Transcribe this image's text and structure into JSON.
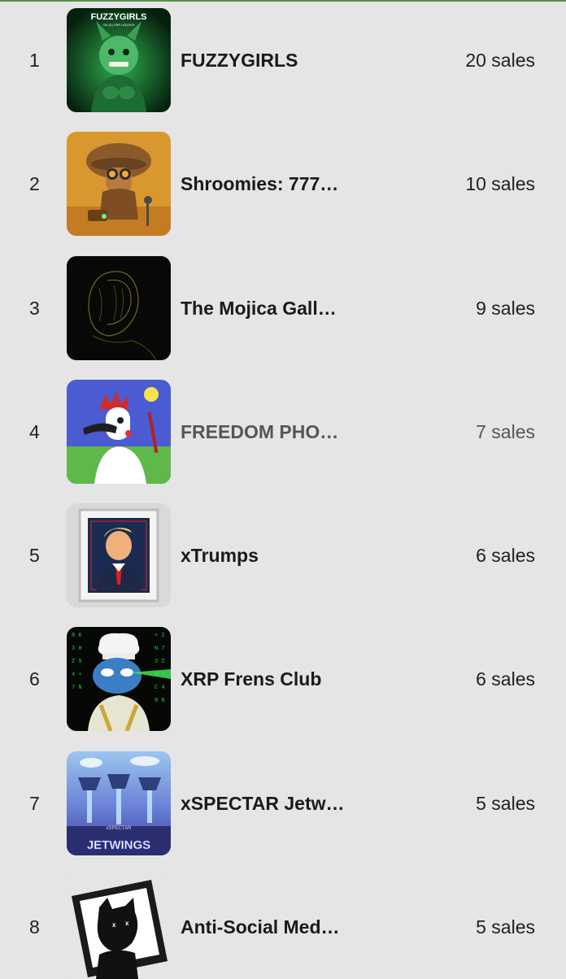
{
  "collections": [
    {
      "rank": "1",
      "name": "FUZZYGIRLS",
      "sales": "20 sales",
      "thumb_text": "FUZZYGIRLS",
      "thumb_subtext": "ON (X) XRP LEDGER"
    },
    {
      "rank": "2",
      "name": "Shroomies: 777…",
      "sales": "10 sales"
    },
    {
      "rank": "3",
      "name": "The Mojica Gall…",
      "sales": "9 sales"
    },
    {
      "rank": "4",
      "name": "FREEDOM PHO…",
      "sales": "7 sales"
    },
    {
      "rank": "5",
      "name": "xTrumps",
      "sales": "6 sales"
    },
    {
      "rank": "6",
      "name": "XRP Frens Club",
      "sales": "6 sales"
    },
    {
      "rank": "7",
      "name": "xSPECTAR Jetw…",
      "sales": "5 sales",
      "thumb_text": "JETWINGS",
      "thumb_subtext": "xSPECTAR"
    },
    {
      "rank": "8",
      "name": "Anti-Social Med…",
      "sales": "5 sales"
    }
  ],
  "colors": {
    "background": "#e5e5e5",
    "text": "#1f1f1f",
    "muted_text": "#555555",
    "top_accent": "#5a8f4e"
  },
  "thumbnail_icons": [
    "fuzzygirls-art-icon",
    "shroomies-art-icon",
    "mojica-gallery-art-icon",
    "freedom-art-icon",
    "xtrumps-portrait-icon",
    "xrp-frens-art-icon",
    "xspectar-jetwings-art-icon",
    "anti-social-art-icon"
  ]
}
